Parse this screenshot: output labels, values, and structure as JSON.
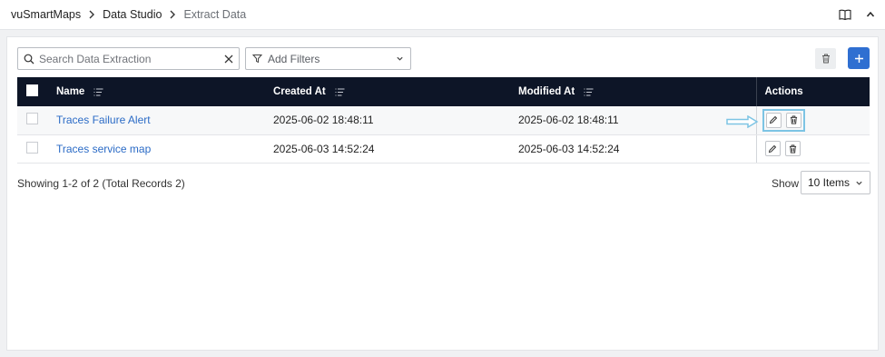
{
  "breadcrumb": [
    "vuSmartMaps",
    "Data Studio",
    "Extract Data"
  ],
  "search": {
    "placeholder": "Search Data Extraction",
    "value": ""
  },
  "filters": {
    "label": "Add Filters"
  },
  "table": {
    "columns": {
      "name": "Name",
      "created": "Created At",
      "modified": "Modified At",
      "actions": "Actions"
    },
    "rows": [
      {
        "name": "Traces Failure Alert",
        "created": "2025-06-02 18:48:11",
        "modified": "2025-06-02 18:48:11"
      },
      {
        "name": "Traces service map",
        "created": "2025-06-03 14:52:24",
        "modified": "2025-06-03 14:52:24"
      }
    ]
  },
  "footer": {
    "summary": "Showing 1-2 of 2 (Total Records 2)",
    "show_label": "Show",
    "items_per_page": "10 Items"
  },
  "colors": {
    "header_bg": "#0d1527",
    "accent": "#2f6fd1",
    "link": "#2b6bc6",
    "highlight": "#7dc4e4"
  },
  "icons": [
    "chevron-right-icon",
    "book-icon",
    "chevron-up-icon",
    "search-icon",
    "clear-icon",
    "filter-icon",
    "chevron-down-icon",
    "trash-icon",
    "plus-icon",
    "sort-icon",
    "edit-icon",
    "arrow-right-icon"
  ]
}
